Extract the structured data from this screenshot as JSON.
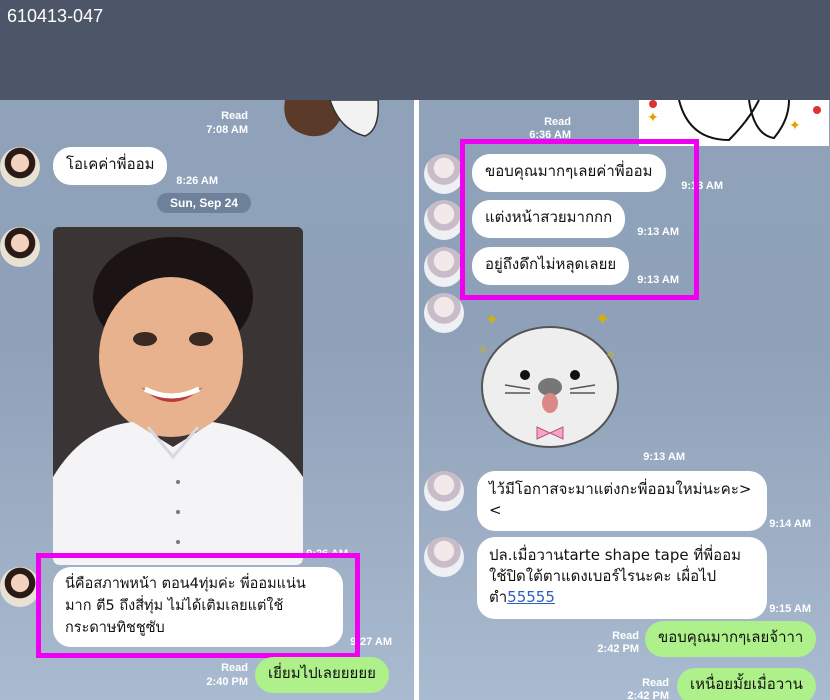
{
  "watermark": "610413-047",
  "left": {
    "top_read": "Read",
    "top_time": "7:08 AM",
    "msg1": "โอเคค่าพี่ออม",
    "msg1_time": "8:26 AM",
    "date": "Sun, Sep 24",
    "photo_time": "9:26 AM",
    "msg2": "นี่คือสภาพหน้า ตอน4ทุ่มค่ะ พี่ออมแน่นมาก ตี5 ถึงสี่ทุ่ม ไม่ได้เติมเลยแต่ใช้กระดาษทิชชูซับ",
    "msg2_time": "9:27 AM",
    "me_read": "Read",
    "me_time": "2:40 PM",
    "me_msg": "เยี่ยมไปเลยยยยย"
  },
  "right": {
    "top_read": "Read",
    "top_time": "6:36 AM",
    "m1": "ขอบคุณมากๆเลยค่าพี่ออม",
    "m1_time": "9:13 AM",
    "m2": "แต่งหน้าสวยมากกก",
    "m2_time": "9:13 AM",
    "m3": "อยู่ถึงดึกไม่หลุดเลยย",
    "m3_time": "9:13 AM",
    "sticker_time": "9:13 AM",
    "m4": "ไว้มีโอกาสจะมาแต่งกะพี่ออมใหม่นะคะ><",
    "m4_time": "9:14 AM",
    "m5_text": "ปล.เมื่อวานtarte shape tape ที่พี่ออมใช้ปิดใต้ตาแดงเบอร์ไรนะคะ เผื่อไปตำ",
    "m5_link": "55555",
    "m5_time": "9:15 AM",
    "me1_read": "Read",
    "me1_time": "2:42 PM",
    "me1": "ขอบคุณมากๆเลยจ้าาา",
    "me2_read": "Read",
    "me2_time": "2:42 PM",
    "me2": "เหนื่อยมั้ยเมื่อวาน"
  }
}
